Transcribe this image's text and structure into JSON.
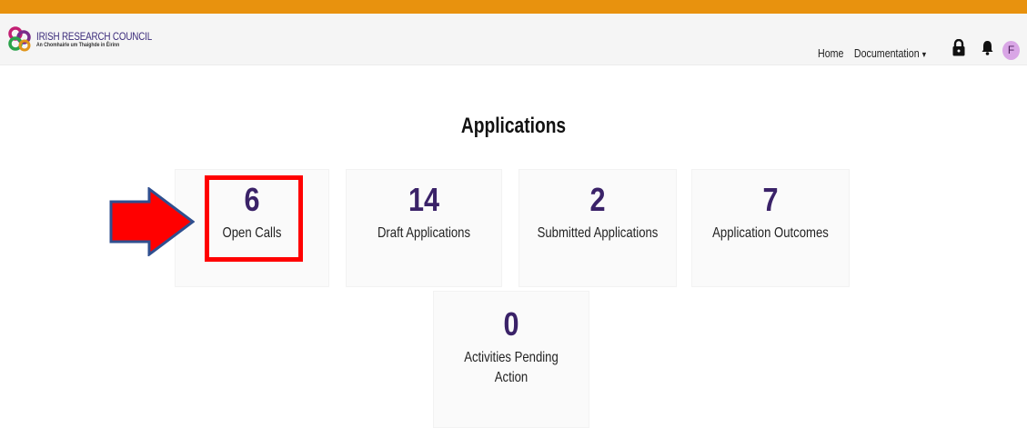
{
  "header": {
    "logo_title": "IRISH RESEARCH COUNCIL",
    "logo_subtitle": "An Chomhairle um Thaighde in Éirinn",
    "nav": [
      {
        "label": "Home"
      },
      {
        "label": "Documentation"
      }
    ],
    "icons": [
      "lock-icon",
      "bell-icon"
    ],
    "avatar_initial": "F"
  },
  "main": {
    "title": "Applications",
    "cards": [
      {
        "value": "6",
        "label": "Open Calls"
      },
      {
        "value": "14",
        "label": "Draft Applications"
      },
      {
        "value": "2",
        "label": "Submitted Applications"
      },
      {
        "value": "7",
        "label": "Application Outcomes"
      },
      {
        "value": "0",
        "label": "Activities Pending Action"
      }
    ]
  },
  "colors": {
    "top_bar": "#e8920e",
    "accent_purple": "#3a2268",
    "highlight": "#ff0000",
    "arrow_fill": "#ff0000",
    "arrow_border": "#2f4f8f"
  }
}
